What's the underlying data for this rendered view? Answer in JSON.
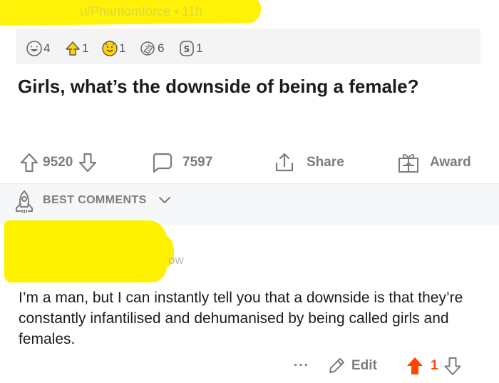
{
  "post": {
    "meta": "u/Phantomforce • 11h",
    "title": "Girls, what’s the downside of being a female?",
    "awards": [
      {
        "icon": "laughing-face-award-icon",
        "count": "4"
      },
      {
        "icon": "up-arrow-award-icon",
        "count": "1"
      },
      {
        "icon": "wholesome-award-icon",
        "count": "1"
      },
      {
        "icon": "face-palm-award-icon",
        "count": "6"
      },
      {
        "icon": "silver-award-icon",
        "count": "1"
      }
    ],
    "actions": {
      "votes": "9520",
      "comments": "7597",
      "share_label": "Share",
      "award_label": "Award"
    }
  },
  "sort": {
    "label": "BEST COMMENTS"
  },
  "comment": {
    "meta": "ow",
    "body": "I’m a man, but I can instantly tell you that a downside is that they’re constantly infantilised and dehumanised by being called girls and females.",
    "ellipsis": "···",
    "edit_label": "Edit",
    "votes": "1"
  },
  "colors": {
    "highlight": "#fff200",
    "upvote_active": "#ff4500",
    "icon_gray": "#7c7c7c"
  }
}
